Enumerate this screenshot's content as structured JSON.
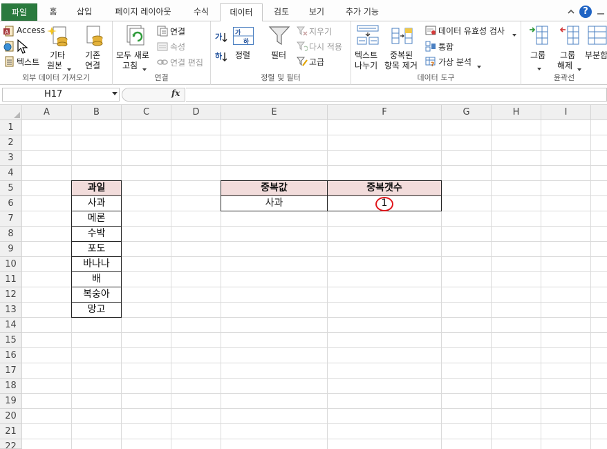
{
  "tabs": {
    "file": "파일",
    "home": "홈",
    "insert": "삽입",
    "page_layout": "페이지 레이아웃",
    "formulas": "수식",
    "data": "데이터",
    "review": "검토",
    "view": "보기",
    "add_ins": "추가 기능"
  },
  "ribbon": {
    "ext": {
      "access": "Access",
      "text": "텍스트",
      "other_1": "기타",
      "other_2": "원본",
      "existing_1": "기존",
      "existing_2": "연결",
      "label": "외부 데이터 가져오기"
    },
    "conn": {
      "refresh_1": "모두 새로",
      "refresh_2": "고침",
      "connections": "연결",
      "properties": "속성",
      "edit_links": "연결 편집",
      "label": "연결"
    },
    "sort": {
      "sort_az": "가",
      "sort_za": "하",
      "sort_dialog": "가하",
      "sort": "정렬",
      "filter": "필터",
      "clear": "지우기",
      "reapply": "다시 적용",
      "advanced": "고급",
      "label": "정렬 및 필터"
    },
    "tools": {
      "text_to_columns_1": "텍스트",
      "text_to_columns_2": "나누기",
      "remove_dup_1": "중복된",
      "remove_dup_2": "항목 제거",
      "validation": "데이터 유효성 검사",
      "consolidate": "통합",
      "what_if": "가상 분석",
      "label": "데이터 도구"
    },
    "outline": {
      "group": "그룹",
      "ungroup": "그룹",
      "ungroup_2": "해제",
      "subtotal": "부분합",
      "label": "윤곽선"
    }
  },
  "formula_bar": {
    "name_box": "H17",
    "fx": "fx",
    "formula": ""
  },
  "columns": [
    "A",
    "B",
    "C",
    "D",
    "E",
    "F",
    "G",
    "H",
    "I"
  ],
  "rows": [
    "1",
    "2",
    "3",
    "4",
    "5",
    "6",
    "7",
    "8",
    "9",
    "10",
    "11",
    "12",
    "13",
    "14",
    "15",
    "16",
    "17",
    "18",
    "19",
    "20",
    "21",
    "22"
  ],
  "cells": {
    "b5": "과일",
    "b6": "사과",
    "b7": "메론",
    "b8": "수박",
    "b9": "포도",
    "b10": "바나나",
    "b11": "배",
    "b12": "복숭아",
    "b13": "망고",
    "e5": "중복값",
    "f5": "중복갯수",
    "e6": "사과",
    "f6": "1"
  },
  "colors": {
    "file_tab": "#2a7a3e",
    "header_fill": "#f2dcdb",
    "annotation_circle": "#e0161c",
    "help_icon": "#1e63c4"
  },
  "icons": {
    "minimize_ribbon": "chevron-up-icon",
    "help": "help-icon",
    "minimize": "minimize-icon",
    "restore": "restore-icon",
    "close": "close-icon"
  }
}
